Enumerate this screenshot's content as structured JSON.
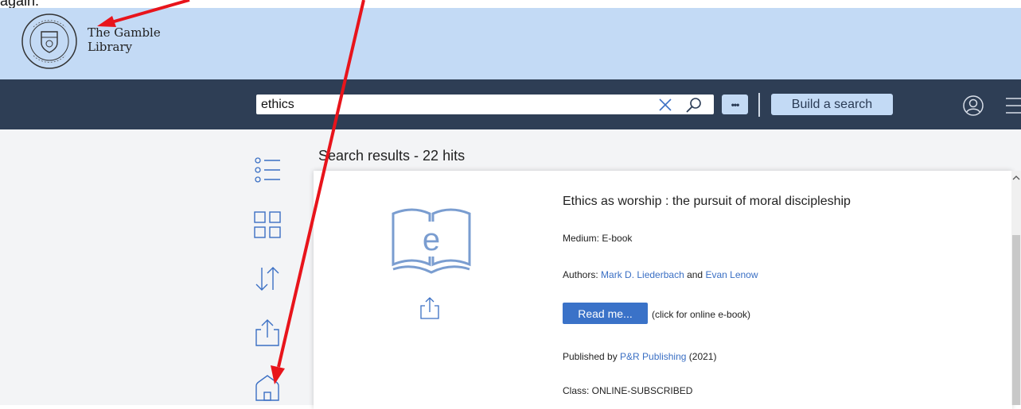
{
  "caption": {
    "text": "again."
  },
  "library": {
    "name_line1": "The Gamble",
    "name_line2": "Library"
  },
  "search": {
    "query": "ethics",
    "more_label": "•••",
    "build_label": "Build a search"
  },
  "results": {
    "title": "Search results - 22 hits"
  },
  "record": {
    "title": "Ethics as worship : the pursuit of moral discipleship",
    "medium_label": "Medium: E-book",
    "authors_prefix": "Authors: ",
    "author1": "Mark D. Liederbach",
    "authors_joiner": " and ",
    "author2": "Evan Lenow",
    "read_button": "Read me...",
    "read_note": "(click for online e-book)",
    "published_prefix": "Published by ",
    "publisher": "P&R Publishing",
    "year": " (2021)",
    "class_label": "Class: ONLINE-SUBSCRIBED",
    "ebook_letter": "e"
  },
  "colors": {
    "banner": "#c3daf5",
    "navbar": "#2e3e55",
    "link": "#3a6fc4",
    "primary_button": "#3a72c8",
    "annotation_arrow": "#e8141b",
    "icon_blue": "#7a9dd0"
  },
  "icons": {
    "seal": "college-seal-icon",
    "clear": "clear-x-icon",
    "search": "magnifier-icon",
    "user": "user-account-icon",
    "menu": "hamburger-menu-icon",
    "list": "list-view-icon",
    "grid": "grid-view-icon",
    "sort": "sort-arrows-icon",
    "share": "share-export-icon",
    "home": "home-icon",
    "ebook": "ebook-icon"
  }
}
